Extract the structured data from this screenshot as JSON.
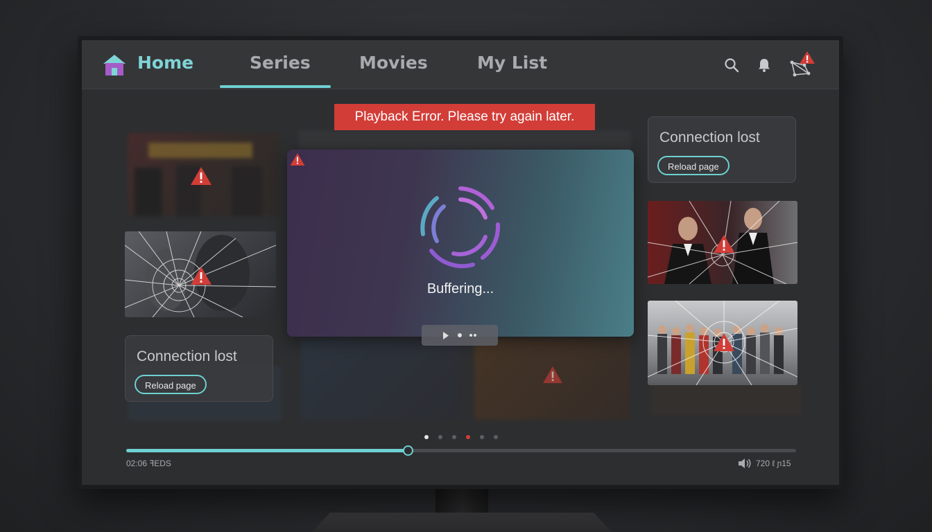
{
  "nav": {
    "home": "Home",
    "tabs": [
      "Series",
      "Movies",
      "My List"
    ],
    "active_tab": "Series",
    "icons": [
      "search-icon",
      "bell-icon",
      "network-error-icon"
    ]
  },
  "error_banner": "Playback Error. Please try again later.",
  "player": {
    "status": "Buffering...",
    "controls": [
      "play-icon",
      "dot",
      "ellipsis"
    ]
  },
  "connection_cards": [
    {
      "title": "Connection lost",
      "button": "Reload page"
    },
    {
      "title": "Connection lost",
      "button": "Reload page"
    }
  ],
  "carousel": {
    "count": 6,
    "active_index": 0,
    "error_index": 3
  },
  "progress": {
    "fraction": 0.42,
    "time_left": "02:06 ꟻEDS",
    "time_right": "720 ℓ ɲ15"
  },
  "colors": {
    "accent": "#6fd0d2",
    "error": "#d23d38",
    "background": "#2d2e30"
  }
}
